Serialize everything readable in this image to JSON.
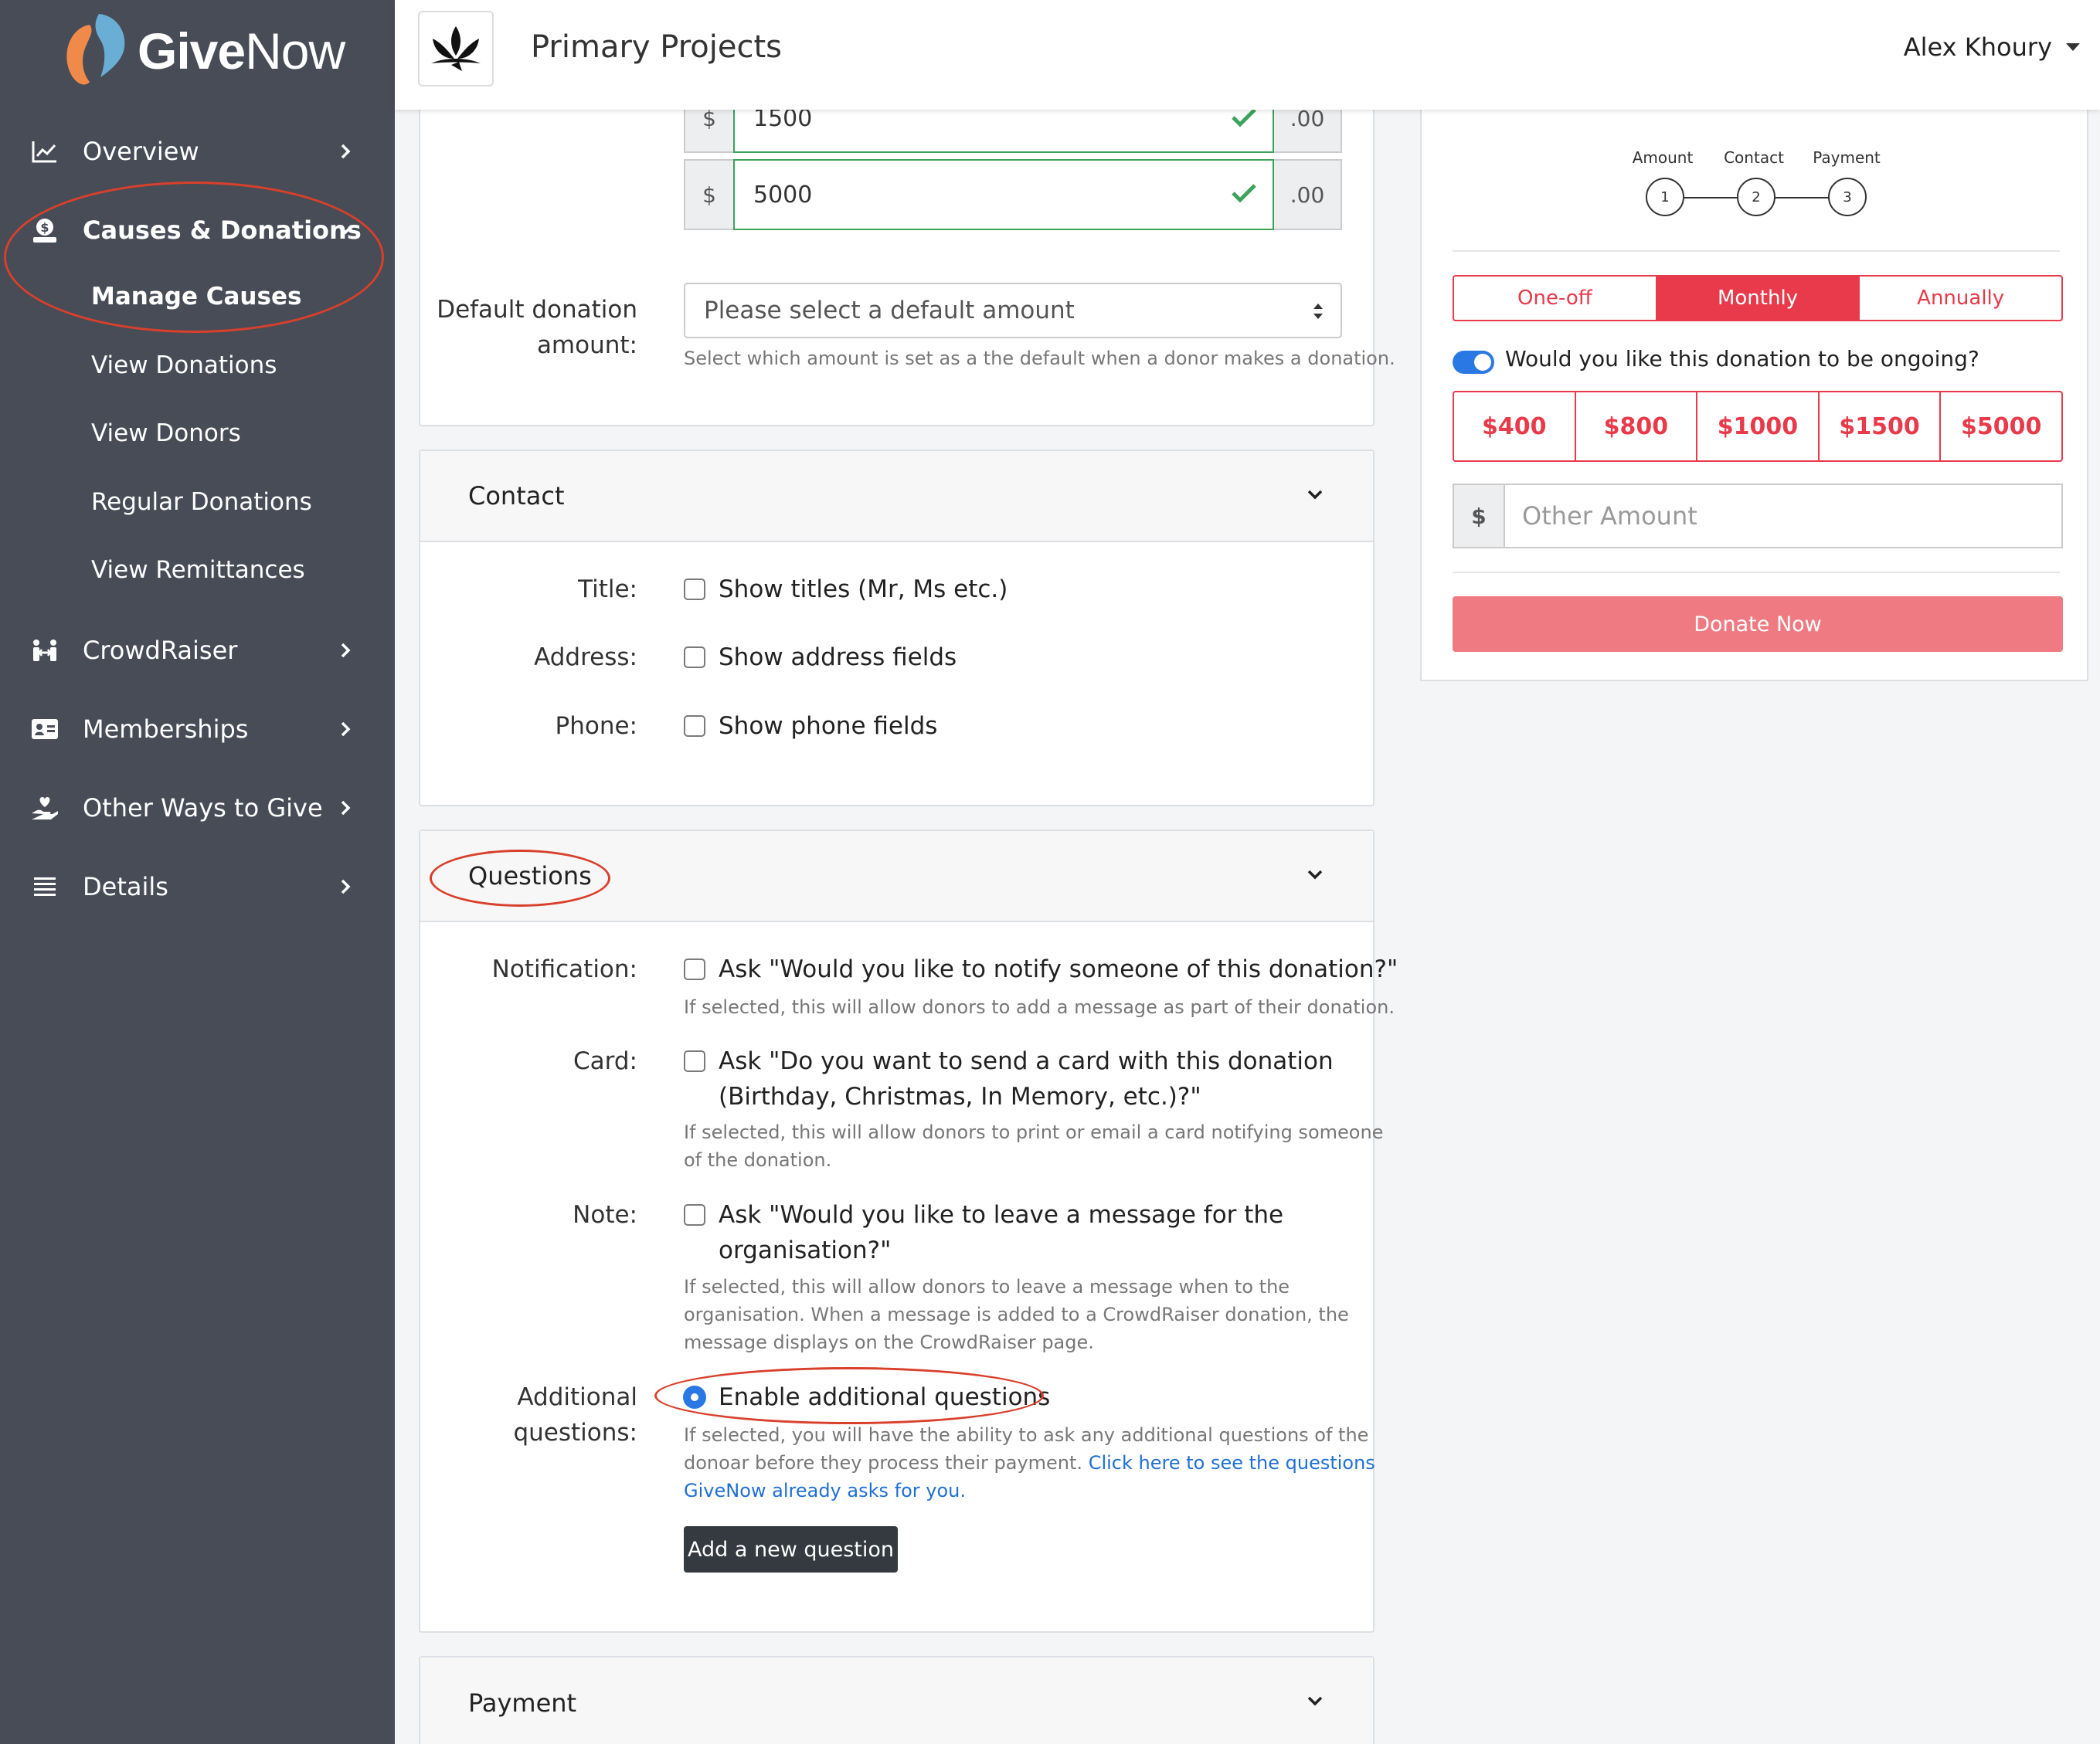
{
  "brand": {
    "name_bold": "Give",
    "name_light": "Now"
  },
  "header": {
    "org_name": "Primary Projects",
    "user_name": "Alex Khoury"
  },
  "sidebar": {
    "items": [
      {
        "label": "Overview",
        "icon": "chart-line-icon"
      },
      {
        "label": "Causes & Donations",
        "icon": "donate-icon"
      },
      {
        "label": "CrowdRaiser",
        "icon": "people-icon"
      },
      {
        "label": "Memberships",
        "icon": "id-card-icon"
      },
      {
        "label": "Other Ways to Give",
        "icon": "hand-holding-icon"
      },
      {
        "label": "Details",
        "icon": "list-icon"
      }
    ],
    "subitems": [
      "Manage Causes",
      "View Donations",
      "View Donors",
      "Regular Donations",
      "View Remittances"
    ]
  },
  "amounts_section": {
    "rows": [
      {
        "prefix": "$",
        "value": "1500",
        "suffix": ".00"
      },
      {
        "prefix": "$",
        "value": "5000",
        "suffix": ".00"
      }
    ],
    "default_label_1": "Default donation",
    "default_label_2": "amount:",
    "default_placeholder": "Please select a default amount",
    "default_help": "Select which amount is set as a the default when a donor makes a donation."
  },
  "contact": {
    "title": "Contact",
    "rows": [
      {
        "label": "Title:",
        "text": "Show titles (Mr, Ms etc.)"
      },
      {
        "label": "Address:",
        "text": "Show address fields"
      },
      {
        "label": "Phone:",
        "text": "Show phone fields"
      }
    ]
  },
  "questions": {
    "title": "Questions",
    "notification": {
      "label": "Notification:",
      "text": "Ask \"Would you like to notify someone of this donation?\"",
      "help": "If selected, this will allow donors to add a message as part of their donation."
    },
    "card": {
      "label": "Card:",
      "text_1": "Ask \"Do you want to send a card with this donation",
      "text_2": "(Birthday, Christmas, In Memory, etc.)?\"",
      "help_1": "If selected, this will allow donors to print or email a card notifying someone",
      "help_2": "of the donation."
    },
    "note": {
      "label": "Note:",
      "text_1": "Ask \"Would you like to leave a message for the",
      "text_2": "organisation?\"",
      "help_1": "If selected, this will allow donors to leave a message when to the",
      "help_2": "organisation. When a message is added to a CrowdRaiser donation, the",
      "help_3": "message displays on the CrowdRaiser page."
    },
    "additional": {
      "label_1": "Additional",
      "label_2": "questions:",
      "text": "Enable additional questions",
      "help_1": "If selected, you will have the ability to ask any additional questions of the",
      "help_2a": "donoar before they process their payment. ",
      "link_1": "Click here to see the questions",
      "link_2": "GiveNow already asks for you.",
      "button": "Add a new question"
    }
  },
  "payment": {
    "title": "Payment"
  },
  "preview": {
    "steps": [
      {
        "label": "Amount",
        "num": "1"
      },
      {
        "label": "Contact",
        "num": "2"
      },
      {
        "label": "Payment",
        "num": "3"
      }
    ],
    "frequencies": [
      "One-off",
      "Monthly",
      "Annually"
    ],
    "selected_frequency": "Monthly",
    "ongoing_text": "Would you like this donation to be ongoing?",
    "amounts": [
      "$400",
      "$800",
      "$1000",
      "$1500",
      "$5000"
    ],
    "other_prefix": "$",
    "other_placeholder": "Other Amount",
    "donate_button": "Donate Now",
    "accent": "#e83a4a"
  }
}
